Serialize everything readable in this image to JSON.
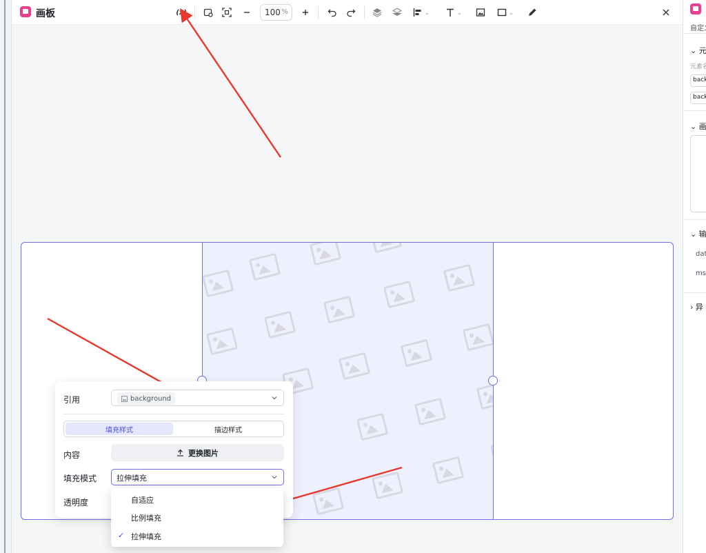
{
  "header": {
    "title": "画板",
    "zoom_value": "100",
    "zoom_unit": "%",
    "variable_label": "(x)"
  },
  "popup": {
    "ref_label": "引用",
    "ref_value": "background",
    "tab_fill": "填充样式",
    "tab_stroke": "描边样式",
    "content_label": "内容",
    "replace_button": "更换图片",
    "fill_mode_label": "填充模式",
    "fill_mode_value": "拉伸填充",
    "opacity_label": "透明度"
  },
  "dropdown": {
    "options": [
      "自适应",
      "比例填充",
      "拉伸填充"
    ],
    "selected": "拉伸填充"
  },
  "right_panel": {
    "custom_text": "自定义",
    "section1": "元",
    "section1_sub": "元素名",
    "field1": "back",
    "field2": "back",
    "section2": "画",
    "section3": "输",
    "item1": "dat",
    "item2": "ms",
    "section4": "异"
  },
  "colors": {
    "accent": "#6f6ee8",
    "brand": "#ea3f8d",
    "arrow": "#e8382d"
  }
}
